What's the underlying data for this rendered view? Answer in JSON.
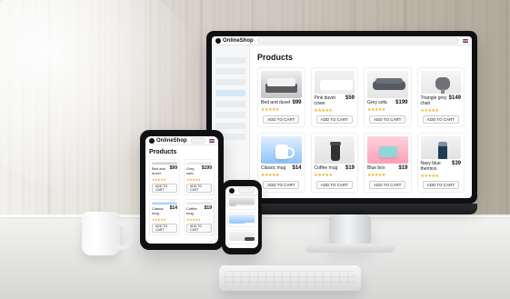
{
  "shop": {
    "brand": "OnlineShop",
    "section_title": "Products",
    "add_to_cart": "ADD TO CART"
  },
  "monitor": {
    "products": [
      {
        "name": "Bed and duvet",
        "price": "$99"
      },
      {
        "name": "Pink duvet cover",
        "price": "$59"
      },
      {
        "name": "Grey sofa",
        "price": "$199"
      },
      {
        "name": "Triangle grey chair",
        "price": "$149"
      },
      {
        "name": "Classic mug",
        "price": "$14"
      },
      {
        "name": "Coffee mug",
        "price": "$19"
      },
      {
        "name": "Blue box",
        "price": "$19"
      },
      {
        "name": "Navy blue thermos",
        "price": "$39"
      }
    ]
  },
  "tablet": {
    "products": [
      {
        "name": "Bed and duvet",
        "price": "$99"
      },
      {
        "name": "Grey sofa",
        "price": "$199"
      },
      {
        "name": "Classic mug",
        "price": "$14"
      },
      {
        "name": "Coffee mug",
        "price": "$19"
      }
    ]
  },
  "ui": {
    "stars": "★★★★★"
  }
}
